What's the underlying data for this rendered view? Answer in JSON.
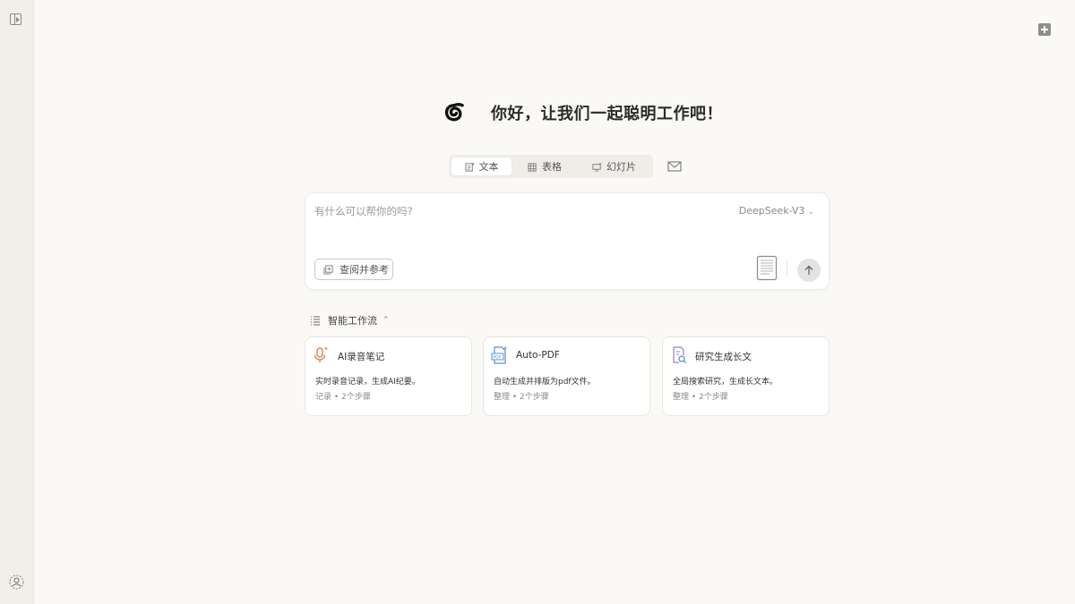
{
  "greeting": "你好，让我们一起聪明工作吧！",
  "mode_tabs": [
    {
      "label": "文本",
      "icon": "text-doc-icon"
    },
    {
      "label": "表格",
      "icon": "table-icon"
    },
    {
      "label": "幻灯片",
      "icon": "slides-icon"
    }
  ],
  "prompt": {
    "placeholder": "有什么可以帮你的吗?",
    "value": "",
    "model": "DeepSeek-V3",
    "reference_button": "查阅并参考"
  },
  "workflow": {
    "title": "智能工作流",
    "cards": [
      {
        "title": "AI录音笔记",
        "desc": "实时录音记录，生成AI纪要。",
        "meta": "记录 • 2个步骤",
        "icon": "microphone-icon"
      },
      {
        "title": "Auto-PDF",
        "desc": "自动生成并排版为pdf文件。",
        "meta": "整理 • 2个步骤",
        "icon": "pdf-file-icon"
      },
      {
        "title": "研究生成长文",
        "desc": "全局搜索研究，生成长文本。",
        "meta": "整理 • 2个步骤",
        "icon": "search-document-icon"
      }
    ]
  },
  "colors": {
    "background": "#faf9f6",
    "sidebar": "#f1efea",
    "accent_orange": "#e0825a",
    "accent_blue": "#5a8fd0",
    "accent_purple": "#9a7fc9"
  }
}
